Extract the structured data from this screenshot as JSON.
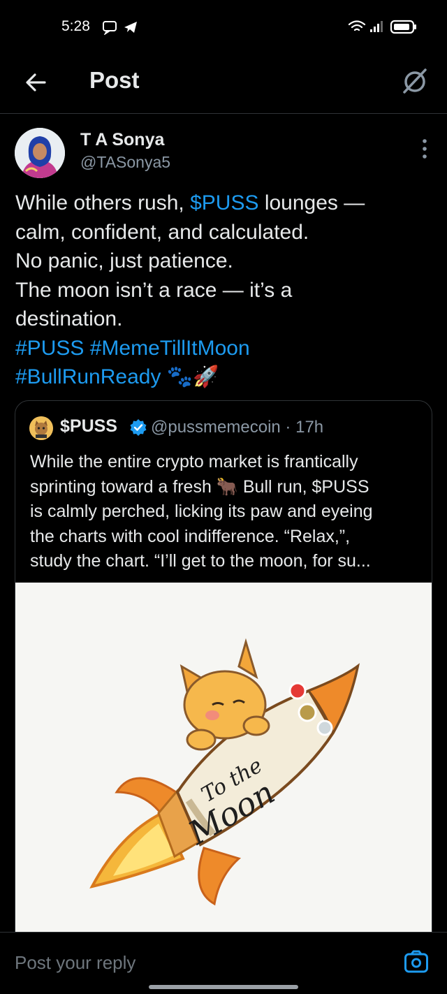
{
  "status_bar": {
    "time": "5:28"
  },
  "header": {
    "title": "Post"
  },
  "author": {
    "name": "T A Sonya",
    "handle": "@TASonya5"
  },
  "post": {
    "lines": [
      [
        "While others rush, ",
        "$PUSS",
        " lounges —"
      ],
      "calm, confident, and calculated.",
      "No panic, just patience.",
      "The moon isn’t a race — it’s a",
      "destination.",
      "#PUSS #MemeTillItMoon",
      "#BullRunReady"
    ],
    "emoji": "🐾🚀"
  },
  "quoted": {
    "name": "$PUSS",
    "handle_time": "@pussmemecoin · 17h",
    "lines": [
      "While the entire crypto market is frantically",
      "sprinting toward a fresh 🐂 Bull run, $PUSS",
      "is calmly perched, licking its paw and eyeing",
      "the charts with cool indifference. “Relax,”,",
      "study the chart. “I’ll get to the moon, for su..."
    ],
    "image_caption_1": "To the",
    "image_caption_2": "Moon"
  },
  "reply": {
    "placeholder": "Post your reply"
  },
  "colors": {
    "accent": "#1d9bf0",
    "background": "#000000",
    "muted": "#8b98a5"
  },
  "icons": [
    "back-arrow-icon",
    "grok-icon",
    "more-vertical-icon",
    "verified-badge-icon",
    "camera-icon",
    "wifi-icon",
    "signal-icon",
    "battery-icon"
  ]
}
